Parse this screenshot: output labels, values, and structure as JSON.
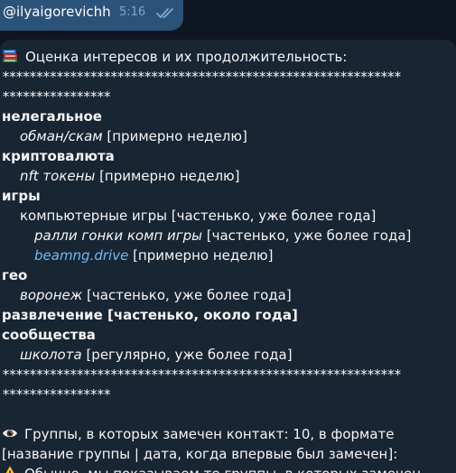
{
  "outgoing": {
    "text": "@ilyaigorevichh",
    "time": "5:16"
  },
  "message": {
    "heading": "Оценка интересов и их продолжительность:",
    "stars_long": "***********************************************************",
    "stars_short": "****************",
    "items": [
      {
        "level": 0,
        "bold": true,
        "italic": false,
        "text": "нелегальное",
        "suffix": ""
      },
      {
        "level": 1,
        "bold": false,
        "italic": true,
        "text": "обман/скам",
        "suffix": " [примерно неделю]"
      },
      {
        "level": 0,
        "bold": true,
        "italic": false,
        "text": "криптовалюта",
        "suffix": ""
      },
      {
        "level": 1,
        "bold": false,
        "italic": true,
        "text": "nft токены",
        "suffix": " [примерно неделю]"
      },
      {
        "level": 0,
        "bold": true,
        "italic": false,
        "text": "игры",
        "suffix": ""
      },
      {
        "level": 1,
        "bold": false,
        "italic": false,
        "text": "компьютерные игры",
        "suffix": " [частенько, уже более года]"
      },
      {
        "level": 2,
        "bold": false,
        "italic": true,
        "text": "ралли гонки комп игры",
        "suffix": " [частенько, уже более года]"
      },
      {
        "level": 2,
        "bold": false,
        "italic": true,
        "link": true,
        "text": "beamng.drive",
        "suffix": " [примерно неделю]"
      },
      {
        "level": 0,
        "bold": true,
        "italic": false,
        "text": "гео",
        "suffix": ""
      },
      {
        "level": 1,
        "bold": false,
        "italic": true,
        "text": "воронеж",
        "suffix": " [частенько, уже более года]"
      },
      {
        "level": 0,
        "bold": true,
        "italic": false,
        "text": "развлечение [частенько, около года]",
        "suffix": ""
      },
      {
        "level": 0,
        "bold": true,
        "italic": false,
        "text": "сообщества",
        "suffix": ""
      },
      {
        "level": 1,
        "bold": false,
        "italic": true,
        "text": "школота",
        "suffix": " [регулярно, уже более года]"
      }
    ],
    "groups_line1": "Группы, в которых замечен контакт: 10, в формате",
    "groups_line2": "[название группы | дата, когда впервые был замечен]:",
    "warning_line": "Обычно, мы показываем те группы, в которых замечен"
  },
  "colors": {
    "background": "#0e1621",
    "outgoing_bubble": "#2b5278",
    "incoming_bubble": "#182533",
    "link": "#71baf2",
    "time": "#7da8d3"
  },
  "icons": {
    "books": "books-emoji-icon",
    "eye": "eye-emoji-icon",
    "warning": "warning-emoji-icon",
    "read": "double-check-icon"
  }
}
